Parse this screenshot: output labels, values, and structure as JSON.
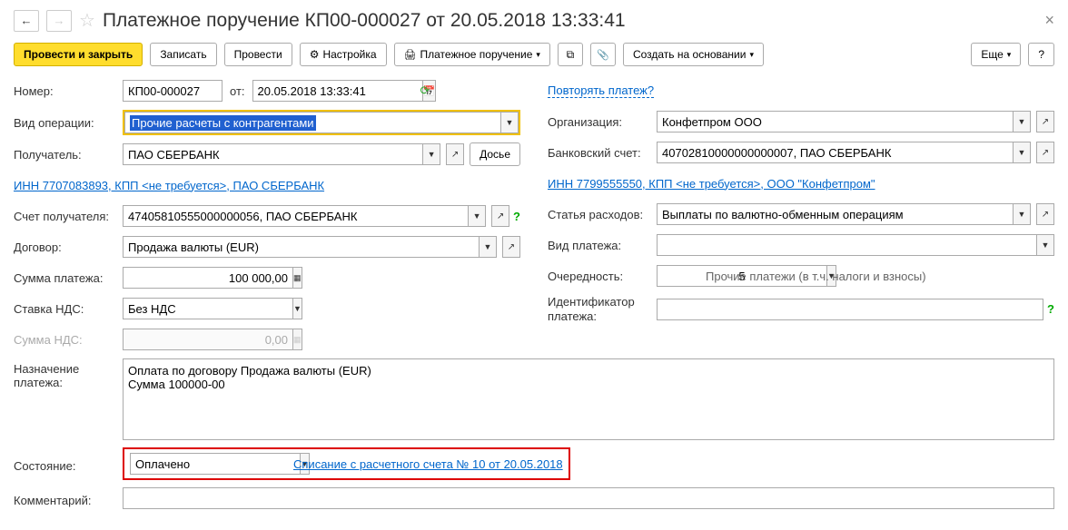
{
  "header": {
    "title": "Платежное поручение КП00-000027 от 20.05.2018 13:33:41"
  },
  "toolbar": {
    "post_close": "Провести и закрыть",
    "save": "Записать",
    "post": "Провести",
    "settings": "Настройка",
    "payment_order": "Платежное поручение",
    "create_based": "Создать на основании",
    "more": "Еще"
  },
  "left": {
    "number_label": "Номер:",
    "number_value": "КП00-000027",
    "from_label": "от:",
    "date_value": "20.05.2018 13:33:41",
    "operation_label": "Вид операции:",
    "operation_value": "Прочие расчеты с контрагентами",
    "recipient_label": "Получатель:",
    "recipient_value": "ПАО СБЕРБАНК",
    "dossier": "Досье",
    "inn_link": "ИНН 7707083893, КПП <не требуется>, ПАО СБЕРБАНК",
    "account_label": "Счет получателя:",
    "account_value": "47405810555000000056, ПАО СБЕРБАНК",
    "contract_label": "Договор:",
    "contract_value": "Продажа валюты (EUR)",
    "sum_label": "Сумма платежа:",
    "sum_value": "100 000,00",
    "vat_rate_label": "Ставка НДС:",
    "vat_rate_value": "Без НДС",
    "vat_sum_label": "Сумма НДС:",
    "vat_sum_value": "0,00"
  },
  "right": {
    "repeat_link": "Повторять платеж?",
    "org_label": "Организация:",
    "org_value": "Конфетпром ООО",
    "bank_label": "Банковский счет:",
    "bank_value": "40702810000000000007, ПАО СБЕРБАНК",
    "inn_link": "ИНН 7799555550, КПП <не требуется>, ООО \"Конфетпром\"",
    "expense_label": "Статья расходов:",
    "expense_value": "Выплаты по валютно-обменным операциям",
    "type_label": "Вид платежа:",
    "priority_label": "Очередность:",
    "priority_value": "5",
    "priority_hint": "Прочие платежи (в т.ч. налоги и взносы)",
    "id_label": "Идентификатор платежа:"
  },
  "bottom": {
    "purpose_label": "Назначение платежа:",
    "purpose_value": "Оплата по договору Продажа валюты (EUR)\nСумма 100000-00",
    "status_label": "Состояние:",
    "status_value": "Оплачено",
    "status_link": "Списание с расчетного счета № 10 от 20.05.2018",
    "comment_label": "Комментарий:"
  }
}
